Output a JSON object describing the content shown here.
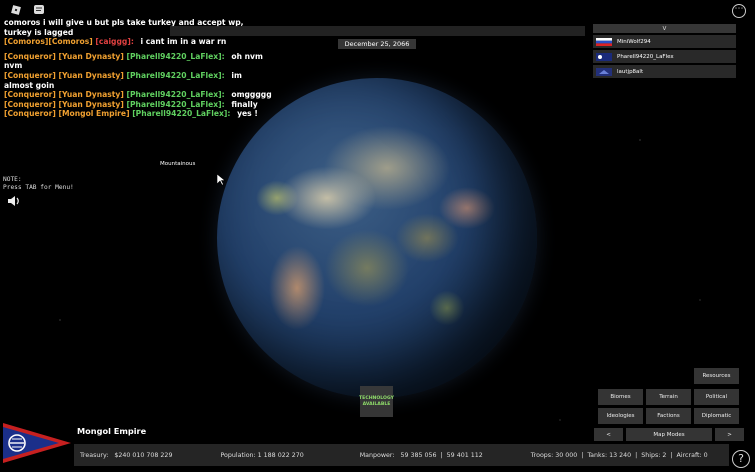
{
  "colors": {
    "tag": "#f0a030",
    "user": "#60d060",
    "rival": "#e04040",
    "tech": "#8fdc6a",
    "panel": "#373737"
  },
  "chat": {
    "top_line_1": "comoros i will give u but pls take turkey and accept wp,",
    "top_line_2": "turkey is lagged",
    "comoros_tag": "[Comoros][Comoros]",
    "comoros_user": "[caiggg]:",
    "comoros_msg": "i cant im in a war rn",
    "lines": [
      {
        "tag": "[Conqueror] [Yuan Dynasty]",
        "user": "[Pharell94220_LaFlex]:",
        "msg": "oh nvm"
      },
      {
        "plain": "nvm"
      },
      {
        "tag": "[Conqueror] [Yuan Dynasty]",
        "user": "[Pharell94220_LaFlex]:",
        "msg": "im"
      },
      {
        "plain": "almost goin"
      },
      {
        "tag": "[Conqueror] [Yuan Dynasty]",
        "user": "[Pharell94220_LaFlex]:",
        "msg": "omggggg"
      },
      {
        "tag": "[Conqueror] [Yuan Dynasty]",
        "user": "[Pharell94220_LaFlex]:",
        "msg": "finally"
      },
      {
        "tag": "[Conqueror] [Mongol Empire]",
        "user": "[Pharell94220_LaFlex]:",
        "msg": "yes !"
      }
    ]
  },
  "date": "December 25, 2066",
  "note": {
    "line1": "NOTE:",
    "line2": "Press TAB for Menu!"
  },
  "hover_label": "Mountainous",
  "players": {
    "toggle": "v",
    "rows": [
      {
        "name": "MiniWolf294",
        "flag": "russia-flag"
      },
      {
        "name": "Pharell94220_LaFlex",
        "flag": "mongol-flag"
      },
      {
        "name": "lautjp8alt",
        "flag": "blue-flag"
      }
    ]
  },
  "tech": {
    "line1": "TECHNOLOGY",
    "line2": "AVAILABLE"
  },
  "map_modes": {
    "resources": "Resources",
    "biomes": "Biomes",
    "terrain": "Terrain",
    "political": "Political",
    "ideologies": "Ideologies",
    "factions": "Factions",
    "diplomatic": "Diplomatic",
    "prev": "<",
    "label": "Map Modes",
    "next": ">"
  },
  "nation": {
    "name": "Mongol Empire"
  },
  "stats": {
    "treasury": "Treasury:   $240 010 708 229",
    "population": "Population: 1 188 022 270",
    "manpower": "Manpower:   59 385 056  |  59 401 112",
    "troops": "Troops: 30 000",
    "tanks": "Tanks: 13 240",
    "ships": "Ships: 2",
    "aircraft": "Aircraft: 0"
  },
  "help": "?"
}
